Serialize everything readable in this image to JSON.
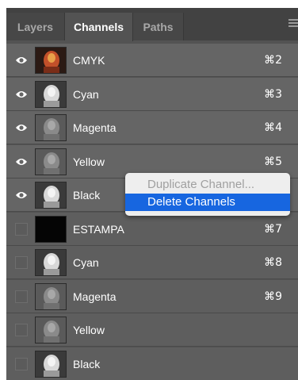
{
  "tabs": [
    {
      "label": "Layers",
      "active": false
    },
    {
      "label": "Channels",
      "active": true
    },
    {
      "label": "Paths",
      "active": false
    }
  ],
  "channels": [
    {
      "name": "CMYK",
      "shortcut": "⌘2",
      "visible": true,
      "thumb": "color"
    },
    {
      "name": "Cyan",
      "shortcut": "⌘3",
      "visible": true,
      "thumb": "light"
    },
    {
      "name": "Magenta",
      "shortcut": "⌘4",
      "visible": true,
      "thumb": "mid"
    },
    {
      "name": "Yellow",
      "shortcut": "⌘5",
      "visible": true,
      "thumb": "mid"
    },
    {
      "name": "Black",
      "shortcut": "",
      "visible": true,
      "thumb": "light"
    },
    {
      "name": "ESTAMPA",
      "shortcut": "⌘7",
      "visible": false,
      "thumb": "black"
    },
    {
      "name": "Cyan",
      "shortcut": "⌘8",
      "visible": false,
      "thumb": "light"
    },
    {
      "name": "Magenta",
      "shortcut": "⌘9",
      "visible": false,
      "thumb": "mid"
    },
    {
      "name": "Yellow",
      "shortcut": "",
      "visible": false,
      "thumb": "mid"
    },
    {
      "name": "Black",
      "shortcut": "",
      "visible": false,
      "thumb": "light"
    }
  ],
  "context_menu": {
    "items": [
      {
        "label": "Duplicate Channel...",
        "state": "disabled"
      },
      {
        "label": "Delete Channels",
        "state": "selected"
      }
    ]
  },
  "icons": {
    "visibility": "eye-icon",
    "panel_menu": "panel-menu-icon"
  },
  "colors": {
    "panel_bg": "#535353",
    "row_bg": "#656565",
    "menu_highlight": "#1766e0"
  }
}
